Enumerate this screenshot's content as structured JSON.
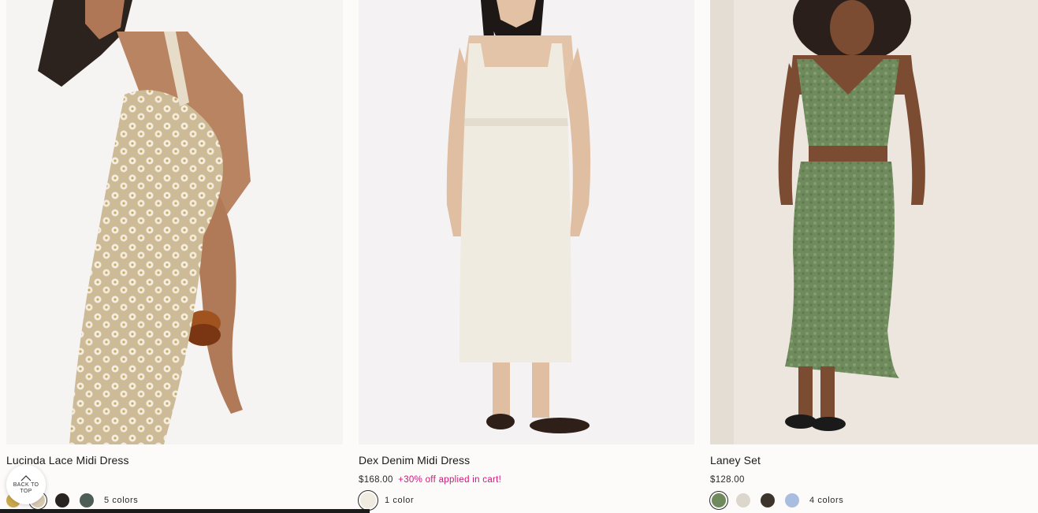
{
  "products": [
    {
      "name": "Lucinda Lace Midi Dress",
      "price": "",
      "promo": "",
      "color_count": "5 colors",
      "swatches": [
        "#c9a84e",
        "#d9cbb2",
        "#2a2420",
        "#4c5e55"
      ],
      "selected_swatch": 1,
      "image_icon": "lace-dress-photo"
    },
    {
      "name": "Dex Denim Midi Dress",
      "price": "$168.00",
      "promo": "+30% off applied in cart!",
      "color_count": "1 color",
      "swatches": [
        "#efebe0"
      ],
      "selected_swatch": 0,
      "image_icon": "white-dress-photo"
    },
    {
      "name": "Laney Set",
      "price": "$128.00",
      "promo": "",
      "color_count": "4 colors",
      "swatches": [
        "#6f8a5c",
        "#dcd6cc",
        "#3d342c",
        "#a9bde0"
      ],
      "selected_swatch": 0,
      "image_icon": "green-set-photo"
    }
  ],
  "back_to_top": {
    "label": "BACK TO TOP",
    "icon": "chevron-up-icon"
  },
  "colors": {
    "promo": "#d4147a",
    "page_bg": "#fcfbfa"
  }
}
